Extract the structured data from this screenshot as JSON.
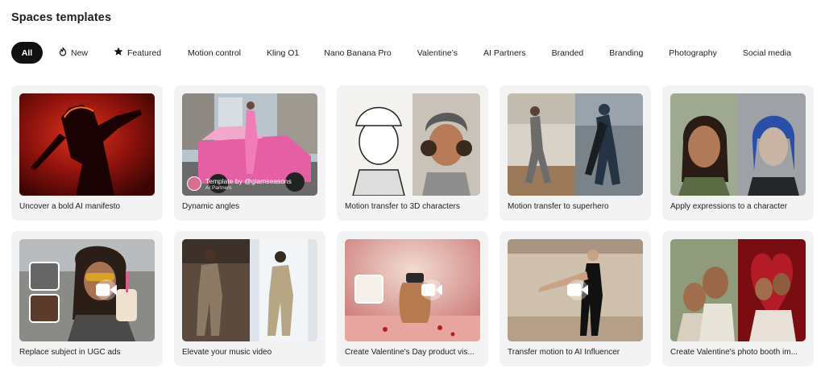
{
  "page": {
    "title": "Spaces templates"
  },
  "filters": [
    {
      "label": "All",
      "icon": "",
      "active": true
    },
    {
      "label": "New",
      "icon": "flame-icon"
    },
    {
      "label": "Featured",
      "icon": "star-icon"
    },
    {
      "label": "Motion control",
      "icon": ""
    },
    {
      "label": "Kling O1",
      "icon": ""
    },
    {
      "label": "Nano Banana Pro",
      "icon": ""
    },
    {
      "label": "Valentine's",
      "icon": ""
    },
    {
      "label": "AI Partners",
      "icon": ""
    },
    {
      "label": "Branded",
      "icon": ""
    },
    {
      "label": "Branding",
      "icon": ""
    },
    {
      "label": "Photography",
      "icon": ""
    },
    {
      "label": "Social media",
      "icon": ""
    }
  ],
  "templates": [
    {
      "caption": "Uncover a bold AI manifesto"
    },
    {
      "caption": "Dynamic angles",
      "author": "Template by @glamseasons",
      "author_sub": "AI Partners"
    },
    {
      "caption": "Motion transfer to 3D characters"
    },
    {
      "caption": "Motion transfer to superhero"
    },
    {
      "caption": "Apply expressions to a character"
    },
    {
      "caption": "Replace subject in UGC ads"
    },
    {
      "caption": "Elevate your music video"
    },
    {
      "caption": "Create Valentine's Day product vis..."
    },
    {
      "caption": "Transfer motion to AI Influencer"
    },
    {
      "caption": "Create Valentine's photo booth im..."
    }
  ]
}
